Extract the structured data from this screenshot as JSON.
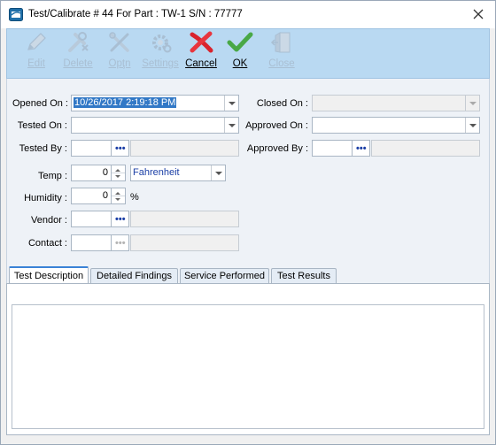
{
  "window": {
    "title": "Test/Calibrate # 44 For Part : TW-1  S/N : 77777"
  },
  "toolbar": {
    "edit_label": "Edit",
    "delete_label": "Delete",
    "open_label": "Opţn",
    "settings_label": "Settings",
    "cancel_label": "Cancel",
    "ok_label": "OK",
    "close_label": "Close"
  },
  "form": {
    "opened_on_label": "Opened On :",
    "opened_on_value": "10/26/2017 2:19:18 PM",
    "tested_on_label": "Tested On :",
    "tested_on_value": "",
    "tested_by_label": "Tested By :",
    "tested_by_value": "",
    "tested_by_name": "",
    "temp_label": "Temp :",
    "temp_value": "0",
    "temp_unit": "Fahrenheit",
    "humidity_label": "Humidity :",
    "humidity_value": "0",
    "humidity_unit": "%",
    "vendor_label": "Vendor :",
    "vendor_value": "",
    "vendor_name": "",
    "contact_label": "Contact :",
    "contact_value": "",
    "contact_name": "",
    "closed_on_label": "Closed On :",
    "closed_on_value": "",
    "approved_on_label": "Approved On :",
    "approved_on_value": "",
    "approved_by_label": "Approved By :",
    "approved_by_value": "",
    "approved_by_name": "",
    "ellipsis": "•••"
  },
  "tabs": [
    {
      "label": "Test Description"
    },
    {
      "label": "Detailed Findings"
    },
    {
      "label": "Service Performed"
    },
    {
      "label": "Test Results"
    }
  ],
  "test_description": {
    "text": ""
  },
  "colors": {
    "toolbar_bg": "#b9d9f2",
    "cancel_red": "#d9232d",
    "ok_green": "#49a846",
    "disabled_icon": "#a9bfd3",
    "selection": "#3178c6",
    "ellipsis_blue": "#1b3fa6"
  },
  "icons": [
    "app-icon",
    "close-icon",
    "pencil-icon",
    "wrench-delete-icon",
    "tools-icon",
    "gear-icon",
    "cancel-x-icon",
    "ok-check-icon",
    "door-exit-icon"
  ]
}
